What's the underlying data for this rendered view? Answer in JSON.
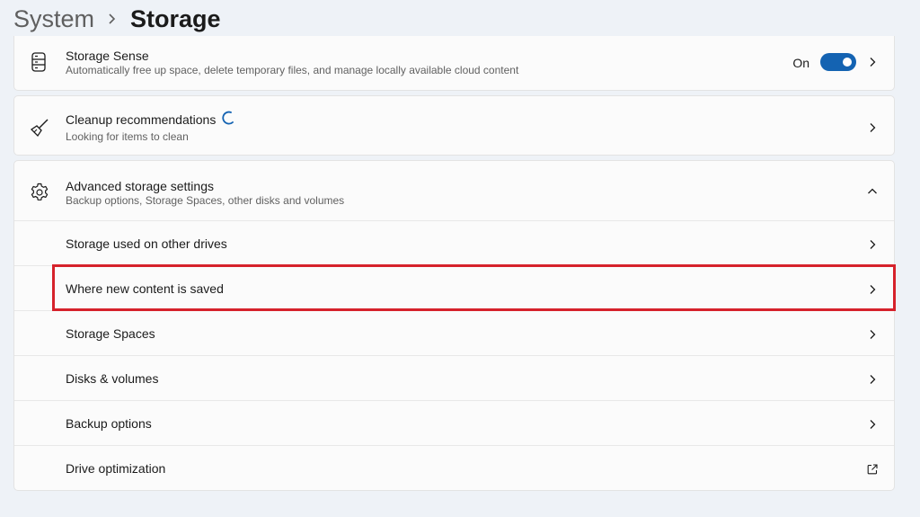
{
  "breadcrumb": {
    "parent": "System",
    "current": "Storage"
  },
  "storage_sense": {
    "title": "Storage Sense",
    "subtitle": "Automatically free up space, delete temporary files, and manage locally available cloud content",
    "toggle_label": "On",
    "toggle_state": "on",
    "icon": "storage-drive-icon"
  },
  "cleanup": {
    "title": "Cleanup recommendations",
    "subtitle": "Looking for items to clean",
    "icon": "broom-icon",
    "status": "loading-spinner"
  },
  "advanced": {
    "title": "Advanced storage settings",
    "subtitle": "Backup options, Storage Spaces, other disks and volumes",
    "icon": "gear-icon",
    "expanded": true,
    "items": [
      {
        "label": "Storage used on other drives",
        "icon": "chevron-right-icon"
      },
      {
        "label": "Where new content is saved",
        "icon": "chevron-right-icon",
        "highlighted": true
      },
      {
        "label": "Storage Spaces",
        "icon": "chevron-right-icon"
      },
      {
        "label": "Disks & volumes",
        "icon": "chevron-right-icon"
      },
      {
        "label": "Backup options",
        "icon": "chevron-right-icon"
      },
      {
        "label": "Drive optimization",
        "icon": "external-link-icon"
      }
    ]
  },
  "colors": {
    "accent": "#1463b2",
    "highlight": "#d6222b",
    "background": "#eef2f7"
  }
}
